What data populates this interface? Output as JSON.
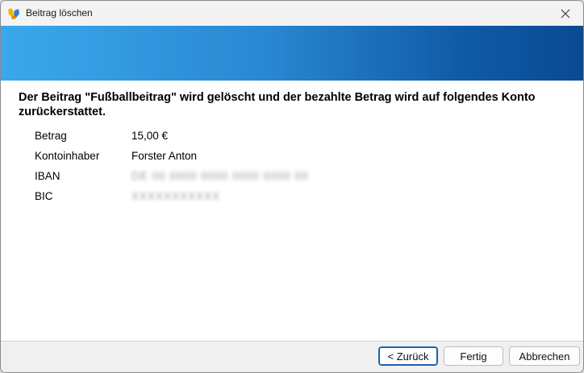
{
  "window": {
    "title": "Beitrag löschen"
  },
  "message": "Der Beitrag \"Fußballbeitrag\" wird gelöscht und der bezahlte Betrag wird auf folgendes Konto zurückerstattet.",
  "details": [
    {
      "label": "Betrag",
      "value": "15,00 €"
    },
    {
      "label": "Kontoinhaber",
      "value": "Forster Anton"
    },
    {
      "label": "IBAN",
      "value": "DE 00 0000 0000 0000 0000 00"
    },
    {
      "label": "BIC",
      "value": "XXXXXXXXXXX"
    }
  ],
  "footer": {
    "back_label": "< Zurück",
    "finish_label": "Fertig",
    "cancel_label": "Abbrechen"
  },
  "colors": {
    "banner_start": "#3aa8ec",
    "banner_end": "#0a4a92",
    "primary_border": "#1f5fb0"
  }
}
